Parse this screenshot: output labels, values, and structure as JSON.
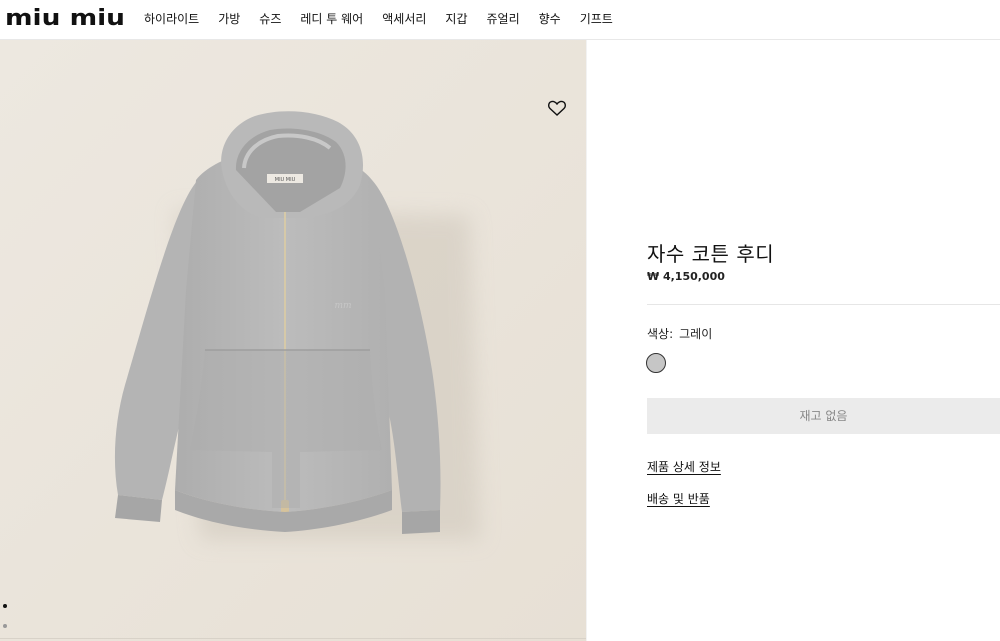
{
  "brand": {
    "logo_text": "miu miu"
  },
  "nav": {
    "items": [
      {
        "label": "하이라이트"
      },
      {
        "label": "가방"
      },
      {
        "label": "슈즈"
      },
      {
        "label": "레디 투 웨어"
      },
      {
        "label": "액세서리"
      },
      {
        "label": "지갑"
      },
      {
        "label": "쥬얼리"
      },
      {
        "label": "향수"
      },
      {
        "label": "기프트"
      }
    ]
  },
  "product": {
    "title": "자수 코튼 후디",
    "price": "₩ 4,150,000",
    "color_label": "색상:",
    "color_value": "그레이",
    "swatch_color": "#c6c6c6",
    "stock_button": "재고 없음",
    "link_details": "제품 상세 정보",
    "link_shipping": "배송 및 반품",
    "tag_text": "MIU MIU"
  },
  "gallery": {
    "image_count": 2,
    "active_index": 0,
    "icons": [
      "heart-icon"
    ]
  },
  "colors": {
    "background_image": "#ebe5dc",
    "garment": "#b8b8b8",
    "button_bg": "#ebebeb",
    "button_text": "#888888"
  }
}
